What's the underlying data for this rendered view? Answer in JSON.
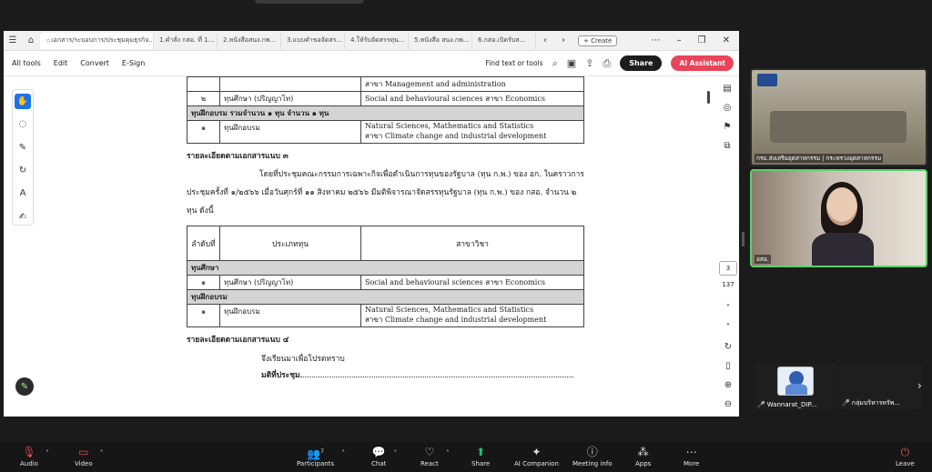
{
  "browser": {
    "active_tab": "เอกสาร/ระบอบการ/ประชุมคุมธุรกิจ...",
    "tabs": [
      "1.คำสั่ง กสอ. ที่ 1...",
      "2.หนังสือสนง.กพ...",
      "3.แบบคำขอจัดสร...",
      "4.ให้รับจัดสรรทุน...",
      "5.หนังสือ สนง.กพ...",
      "6.กสอ.เปิดรับส..."
    ],
    "create_label": "Create"
  },
  "toolbar": {
    "menus": [
      "All tools",
      "Edit",
      "Convert",
      "E-Sign"
    ],
    "find_label": "Find text or tools",
    "share_label": "Share",
    "ai_label": "AI Assistant"
  },
  "document": {
    "table1": {
      "row_continued_field": "สาขา Management and administration",
      "row2_no": "๒",
      "row2_type": "ทุนศึกษา (ปริญญาโท)",
      "row2_field": "Social and behavioural sciences สาขา Economics",
      "section_training": "ทุนฝึกอบรม รวมจำนวน ๑ ทุน  จำนวน ๑ ทุน",
      "row3_no": "๑",
      "row3_type": "ทุนฝึกอบรม",
      "row3_field1": "Natural Sciences, Mathematics and Statistics",
      "row3_field2": "สาขา Climate change and industrial development"
    },
    "section3_heading": "รายละเอียดตามเอกสารแนบ ๓",
    "paragraph": "โดยที่ประชุมคณะกรรมการเฉพาะกิจเพื่อดำเนินการทุนของรัฐบาล (ทุน ก.พ.) ของ อก. ในคราวการประชุมครั้งที่ ๑/๒๕๖๖ เมื่อวันศุกร์ที่ ๑๑ สิงหาคม ๒๕๖๖ มีมติพิจารณาจัดสรรทุนรัฐบาล (ทุน ก.พ.) ของ กสอ. จำนวน ๒ ทุน ดังนี้",
    "table2": {
      "head_no": "ลำดับที่",
      "head_type": "ประเภททุน",
      "head_field": "สาขาวิชา",
      "section_study": "ทุนศึกษา",
      "study_no": "๑",
      "study_type": "ทุนศึกษา (ปริญญาโท)",
      "study_field": "Social and behavioural sciences สาขา Economics",
      "section_training": "ทุนฝึกอบรม",
      "train_no": "๑",
      "train_type": "ทุนฝึกอบรม",
      "train_field1": "Natural Sciences, Mathematics and Statistics",
      "train_field2": "สาขา Climate change and industrial development"
    },
    "section4_heading": "รายละเอียดตามเอกสารแนบ ๔",
    "closing": "จึงเรียนมาเพื่อโปรดทราบ",
    "resolution": "มติที่ประชุม"
  },
  "viewer": {
    "page_number": "3",
    "page_total": "137"
  },
  "video": {
    "tile1_label": "กรม.ส่งเสริมอุตสาหกรรม | กระทรวงอุตสาหกรรม",
    "tile2_label": "อสอ.",
    "small1_label": "Wannarat_DIP...",
    "small2_label": "กลุ่มบริหารทรัพ..."
  },
  "meeting_bar": {
    "audio": "Audio",
    "video": "Video",
    "participants": "Participants",
    "participants_count": "7",
    "chat": "Chat",
    "react": "React",
    "share": "Share",
    "ai_companion": "AI Companion",
    "meeting_info": "Meeting info",
    "apps": "Apps",
    "more": "More",
    "leave": "Leave"
  }
}
